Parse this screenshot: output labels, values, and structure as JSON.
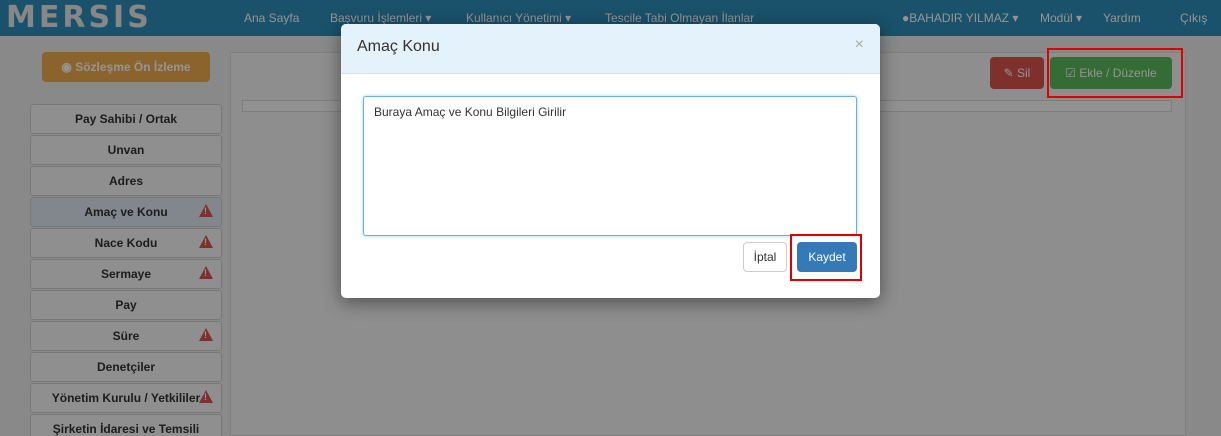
{
  "navbar": {
    "logo": "MERSIS",
    "items": [
      "Ana Sayfa",
      "Başvuru İşlemleri ▾",
      "Kullanıcı Yönetimi ▾",
      "Tescile Tabi Olmayan İlanlar"
    ],
    "user": "BAHADIR YILMAZ ▾",
    "modul": "Modül ▾",
    "yardim": "Yardım",
    "cikis": "Çıkış"
  },
  "left": {
    "preview_button": "Sözleşme Ön İzleme"
  },
  "sidebar": {
    "items": [
      {
        "label": "Pay Sahibi / Ortak",
        "warning": false
      },
      {
        "label": "Unvan",
        "warning": false
      },
      {
        "label": "Adres",
        "warning": false
      },
      {
        "label": "Amaç ve Konu",
        "warning": true,
        "active": true
      },
      {
        "label": "Nace Kodu",
        "warning": true
      },
      {
        "label": "Sermaye",
        "warning": true
      },
      {
        "label": "Pay",
        "warning": false
      },
      {
        "label": "Süre",
        "warning": true
      },
      {
        "label": "Denetçiler",
        "warning": false
      },
      {
        "label": "Yönetim Kurulu / Yetkililer",
        "warning": true
      },
      {
        "label": "Şirketin İdaresi ve Temsili",
        "warning": false
      }
    ]
  },
  "toolbar": {
    "sil_label": "Sil",
    "ekle_label": "Ekle / Düzenle"
  },
  "modal": {
    "title": "Amaç Konu",
    "close": "×",
    "textarea_value": "Buraya Amaç ve Konu Bilgileri Girilir",
    "cancel_label": "İptal",
    "save_label": "Kaydet"
  },
  "colors": {
    "navbar": "#2e8cb8",
    "save": "#337ab7",
    "ekle": "#5cb85c",
    "sil": "#d9534f",
    "highlight": "#e00000"
  }
}
